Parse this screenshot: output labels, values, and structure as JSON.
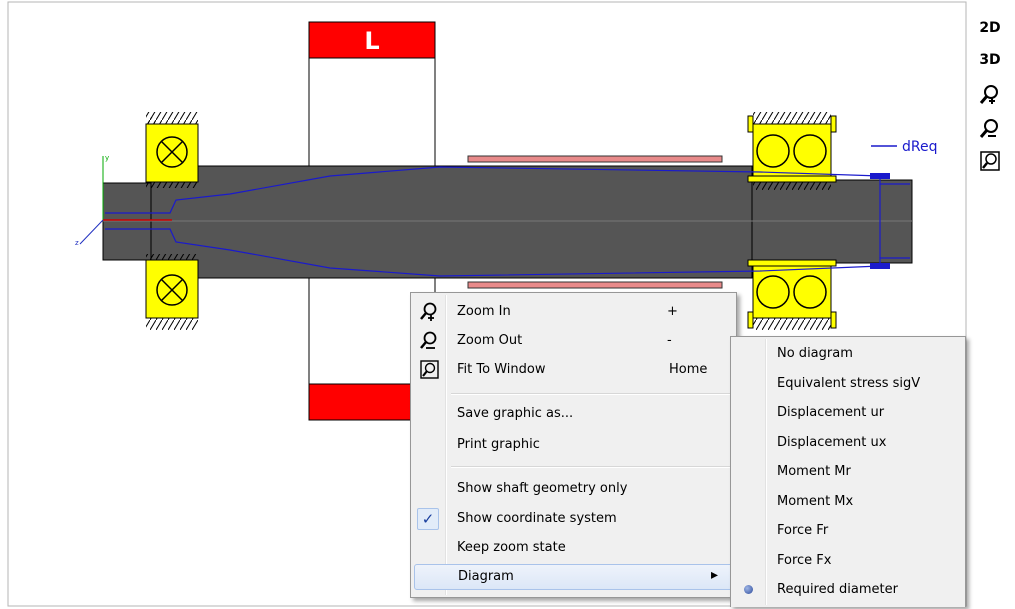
{
  "canvas": {
    "bearing_label": "L",
    "legend_label": "dReq",
    "coord_y": "y",
    "coord_z": "z",
    "colors": {
      "shaft": "#555555",
      "bearing": "#ffff00",
      "load": "#ff0000",
      "diagram": "#0000cc",
      "part": "#e88a8a"
    }
  },
  "toolbar": {
    "btn_2d": "2D",
    "btn_3d": "3D",
    "zoom_in_icon": "zoom-in-icon",
    "zoom_out_icon": "zoom-out-icon",
    "fit_icon": "fit-window-icon"
  },
  "context_menu": {
    "zoom_in": {
      "label": "Zoom In",
      "shortcut": "+"
    },
    "zoom_out": {
      "label": "Zoom Out",
      "shortcut": "-"
    },
    "fit_to_window": {
      "label": "Fit To Window",
      "shortcut": "Home"
    },
    "save_graphic": {
      "label": "Save graphic as..."
    },
    "print_graphic": {
      "label": "Print graphic"
    },
    "show_geometry": {
      "label": "Show shaft geometry only"
    },
    "show_coord": {
      "label": "Show coordinate system",
      "checked": true,
      "check_glyph": "✓"
    },
    "keep_zoom": {
      "label": "Keep zoom state"
    },
    "diagram": {
      "label": "Diagram",
      "arrow": "▸"
    }
  },
  "submenu": {
    "items": [
      "No diagram",
      "Equivalent stress sigV",
      "Displacement ur",
      "Displacement ux",
      "Moment Mr",
      "Moment Mx",
      "Force Fr",
      "Force Fx",
      "Required diameter"
    ],
    "selected": "Required diameter"
  }
}
